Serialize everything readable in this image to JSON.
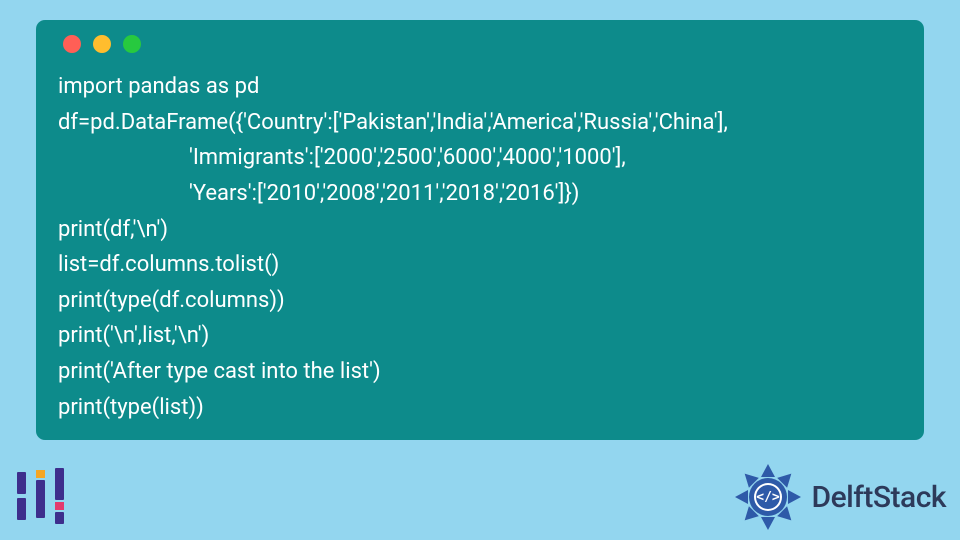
{
  "code_lines": [
    "import pandas as pd",
    "df=pd.DataFrame({'Country':['Pakistan','India','America','Russia','China'],",
    "                        'Immigrants':['2000','2500','6000','4000','1000'],",
    "                        'Years':['2010','2008','2011','2018','2016']})",
    "print(df,'\\n')",
    "list=df.columns.tolist()",
    "print(type(df.columns))",
    "print('\\n',list,'\\n')",
    "print('After type cast into the list')",
    "print(type(list))"
  ],
  "brand": {
    "name": "DelftStack"
  },
  "traffic": {
    "red": "close",
    "yellow": "minimize",
    "green": "zoom"
  },
  "colors": {
    "page_bg": "#93d6ef",
    "block_bg": "#0d8b8b",
    "code_fg": "#ffffff",
    "brand_fg": "#2d3a5a",
    "emblem": "#2e5aa8"
  }
}
